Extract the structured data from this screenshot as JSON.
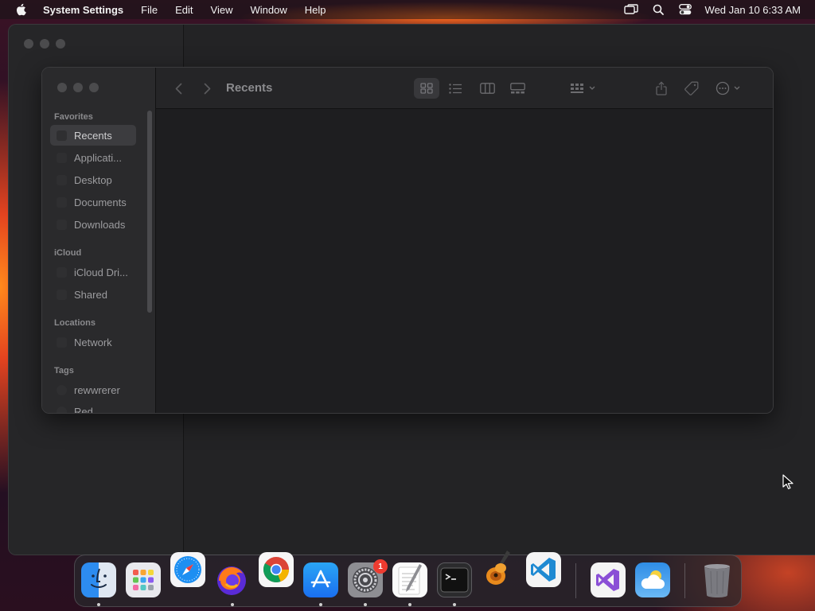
{
  "menubar": {
    "app_name": "System Settings",
    "menus": [
      "File",
      "Edit",
      "View",
      "Window",
      "Help"
    ],
    "clock": "Wed Jan 10  6:33 AM"
  },
  "finder": {
    "title": "Recents",
    "sidebar": {
      "favorites_label": "Favorites",
      "favorites": [
        "Recents",
        "Applicati...",
        "Desktop",
        "Documents",
        "Downloads"
      ],
      "icloud_label": "iCloud",
      "icloud": [
        "iCloud Dri...",
        "Shared"
      ],
      "locations_label": "Locations",
      "locations": [
        "Network"
      ],
      "tags_label": "Tags",
      "tags": [
        "rewwrerer",
        "Red"
      ]
    }
  },
  "dock": {
    "apps": [
      "Finder",
      "Launchpad",
      "Safari",
      "Firefox",
      "Chrome",
      "App Store",
      "System Settings",
      "TextEdit",
      "Terminal",
      "GarageBand",
      "VS Code",
      "Visual Studio",
      "Weather",
      "Trash"
    ],
    "settings_badge": "1"
  }
}
